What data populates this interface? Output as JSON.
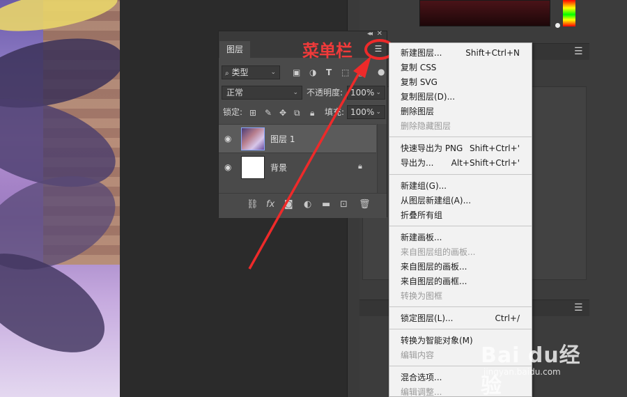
{
  "layers_panel": {
    "tab_label": "图层",
    "filter_kind": "类型",
    "blend_mode": "正常",
    "opacity_label": "不透明度:",
    "opacity_value": "100%",
    "lock_label": "锁定:",
    "fill_label": "填充:",
    "fill_value": "100%",
    "layers": [
      {
        "name": "图层 1",
        "thumbnail": "photo",
        "selected": true,
        "locked": false
      },
      {
        "name": "背景",
        "thumbnail": "white",
        "selected": false,
        "locked": true
      }
    ]
  },
  "annotation": {
    "label": "菜单栏",
    "color": "#ee2a2a"
  },
  "context_menu": {
    "items": [
      {
        "label": "新建图层...",
        "shortcut": "Shift+Ctrl+N",
        "enabled": true
      },
      {
        "label": "复制 CSS",
        "shortcut": "",
        "enabled": true
      },
      {
        "label": "复制 SVG",
        "shortcut": "",
        "enabled": true
      },
      {
        "label": "复制图层(D)...",
        "shortcut": "",
        "enabled": true
      },
      {
        "label": "删除图层",
        "shortcut": "",
        "enabled": true
      },
      {
        "label": "删除隐藏图层",
        "shortcut": "",
        "enabled": false
      },
      {
        "label": "快速导出为 PNG",
        "shortcut": "Shift+Ctrl+'",
        "enabled": true
      },
      {
        "label": "导出为...",
        "shortcut": "Alt+Shift+Ctrl+'",
        "enabled": true
      },
      {
        "label": "新建组(G)...",
        "shortcut": "",
        "enabled": true
      },
      {
        "label": "从图层新建组(A)...",
        "shortcut": "",
        "enabled": true
      },
      {
        "label": "折叠所有组",
        "shortcut": "",
        "enabled": true
      },
      {
        "label": "新建画板...",
        "shortcut": "",
        "enabled": true
      },
      {
        "label": "来自图层组的画板...",
        "shortcut": "",
        "enabled": false
      },
      {
        "label": "来自图层的画板...",
        "shortcut": "",
        "enabled": true
      },
      {
        "label": "来自图层的画框...",
        "shortcut": "",
        "enabled": true
      },
      {
        "label": "转换为图框",
        "shortcut": "",
        "enabled": false
      },
      {
        "label": "锁定图层(L)...",
        "shortcut": "Ctrl+/",
        "enabled": true
      },
      {
        "label": "转换为智能对象(M)",
        "shortcut": "",
        "enabled": true
      },
      {
        "label": "编辑内容",
        "shortcut": "",
        "enabled": false
      },
      {
        "label": "混合选项...",
        "shortcut": "",
        "enabled": true
      },
      {
        "label": "编辑调整...",
        "shortcut": "",
        "enabled": false
      }
    ]
  },
  "watermark": {
    "brand": "Bai du经验",
    "url": "jingyan.baidu.com"
  },
  "icons": {
    "filter_icons": [
      "image-filter-icon",
      "adjustment-filter-icon",
      "type-filter-icon",
      "shape-filter-icon",
      "smartobject-filter-icon"
    ],
    "lock_icons": [
      "lock-transparent-icon",
      "lock-paint-icon",
      "lock-position-icon",
      "lock-artboard-icon",
      "lock-all-icon"
    ],
    "footer_icons": [
      "link-icon",
      "fx-icon",
      "mask-icon",
      "adjustment-layer-icon",
      "group-folder-icon",
      "new-layer-icon",
      "trash-icon"
    ]
  }
}
